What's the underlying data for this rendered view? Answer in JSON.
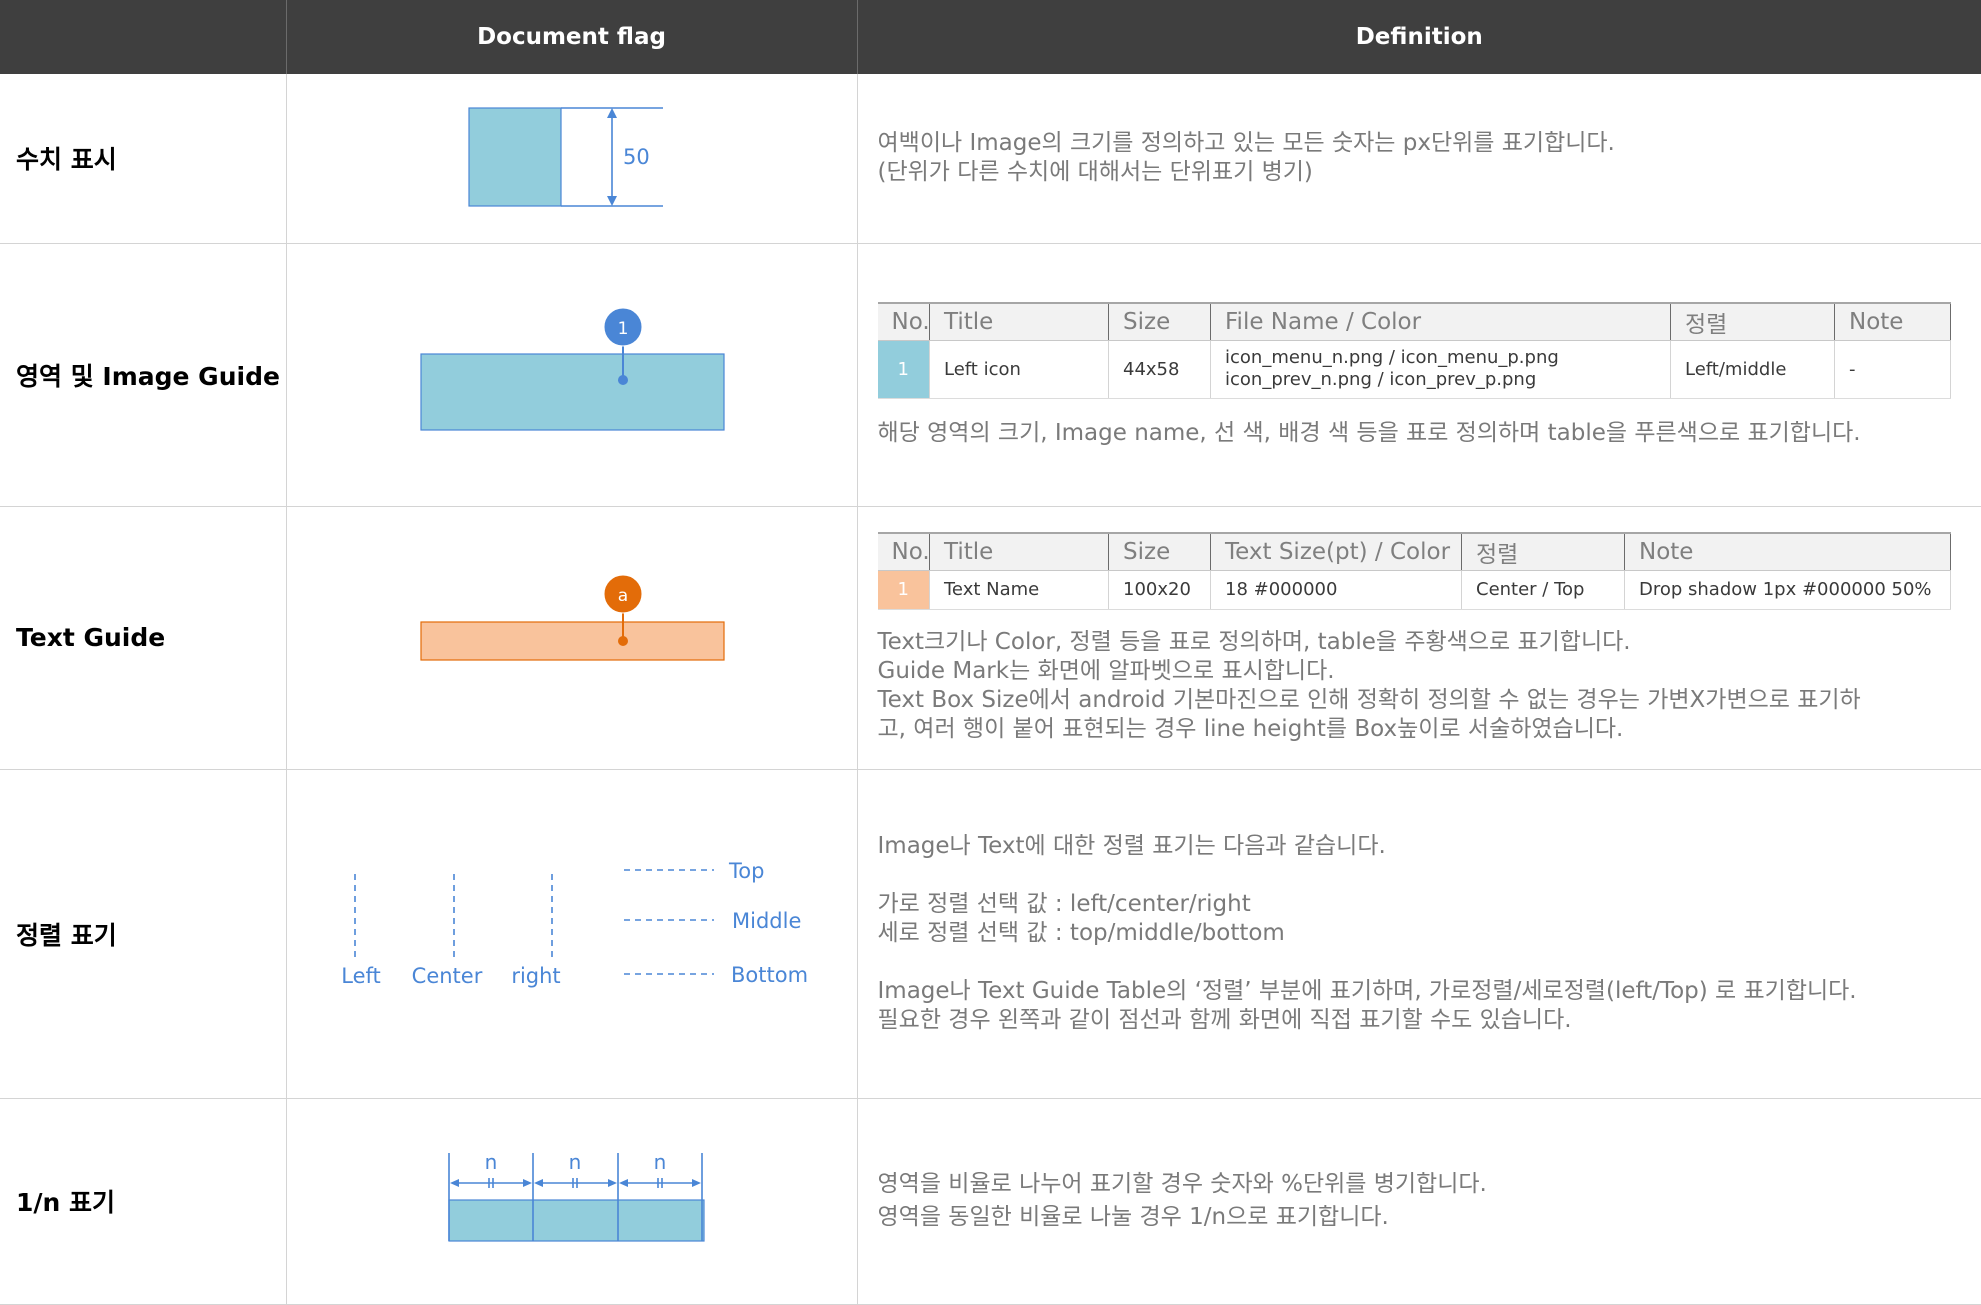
{
  "header": {
    "col_flag": "Document flag",
    "col_def": "Definition"
  },
  "rows": {
    "numeric": {
      "label": "수치 표시",
      "sample_value": "50",
      "lines": [
        "여백이나 Image의 크기를 정의하고 있는 모든 숫자는 px단위를 표기합니다.",
        "(단위가 다른 수치에 대해서는 단위표기 병기)"
      ]
    },
    "image_guide": {
      "label": "영역 및 Image Guide",
      "marker": "1",
      "table": {
        "headers": [
          "No.",
          "Title",
          "Size",
          "File Name / Color",
          "정렬",
          "Note"
        ],
        "row": {
          "no": "1",
          "title": "Left icon",
          "size": "44x58",
          "file_line1": "icon_menu_n.png / icon_menu_p.png",
          "file_line2": "icon_prev_n.png / icon_prev_p.png",
          "align": "Left/middle",
          "note": "-"
        }
      },
      "desc": "해당 영역의 크기, Image name, 선 색, 배경 색 등을 표로 정의하며 table을 푸른색으로 표기합니다."
    },
    "text_guide": {
      "label": "Text Guide",
      "marker": "a",
      "table": {
        "headers": [
          "No.",
          "Title",
          "Size",
          "Text Size(pt) / Color",
          "정렬",
          "Note"
        ],
        "row": {
          "no": "1",
          "title": "Text Name",
          "size": "100x20",
          "text_size": "18 #000000",
          "align": "Center / Top",
          "note": "Drop shadow 1px #000000 50%"
        }
      },
      "lines": [
        "Text크기나 Color, 정렬 등을 표로 정의하며, table을 주황색으로 표기합니다.",
        "Guide Mark는 화면에 알파벳으로 표시합니다.",
        "Text Box Size에서 android 기본마진으로 인해 정확히 정의할 수 없는 경우는 가변X가변으로 표기하",
        "고, 여러 행이 붙어 표현되는 경우 line height를 Box높이로 서술하였습니다."
      ]
    },
    "alignment": {
      "label": "정렬 표기",
      "h_labels": [
        "Left",
        "Center",
        "right"
      ],
      "v_labels": [
        "Top",
        "Middle",
        "Bottom"
      ],
      "line1": "Image나 Text에 대한 정렬 표기는 다음과 같습니다.",
      "line2": "가로 정렬 선택 값 : left/center/right",
      "line3": "세로 정렬 선택 값 : top/middle/bottom",
      "line4": "Image나 Text Guide Table의 ‘정렬’ 부분에 표기하며, 가로정렬/세로정렬(left/Top) 로 표기합니다.",
      "line5": "필요한 경우 왼쪽과 같이 점선과 함께 화면에 직접 표기할 수도 있습니다."
    },
    "ratio": {
      "label": "1/n 표기",
      "segment_label": "n",
      "lines": [
        "영역을 비율로 나누어 표기할 경우 숫자와 %단위를 병기합니다.",
        "영역을 동일한 비율로 나눌 경우 1/n으로 표기합니다."
      ]
    }
  },
  "colors": {
    "header_bg": "#3f3f3f",
    "guide_blue": "#92cddc",
    "guide_orange": "#f9c39c",
    "marker_blue": "#4a86d6",
    "marker_orange": "#e36c09",
    "annotation_blue": "#4a86d6"
  }
}
